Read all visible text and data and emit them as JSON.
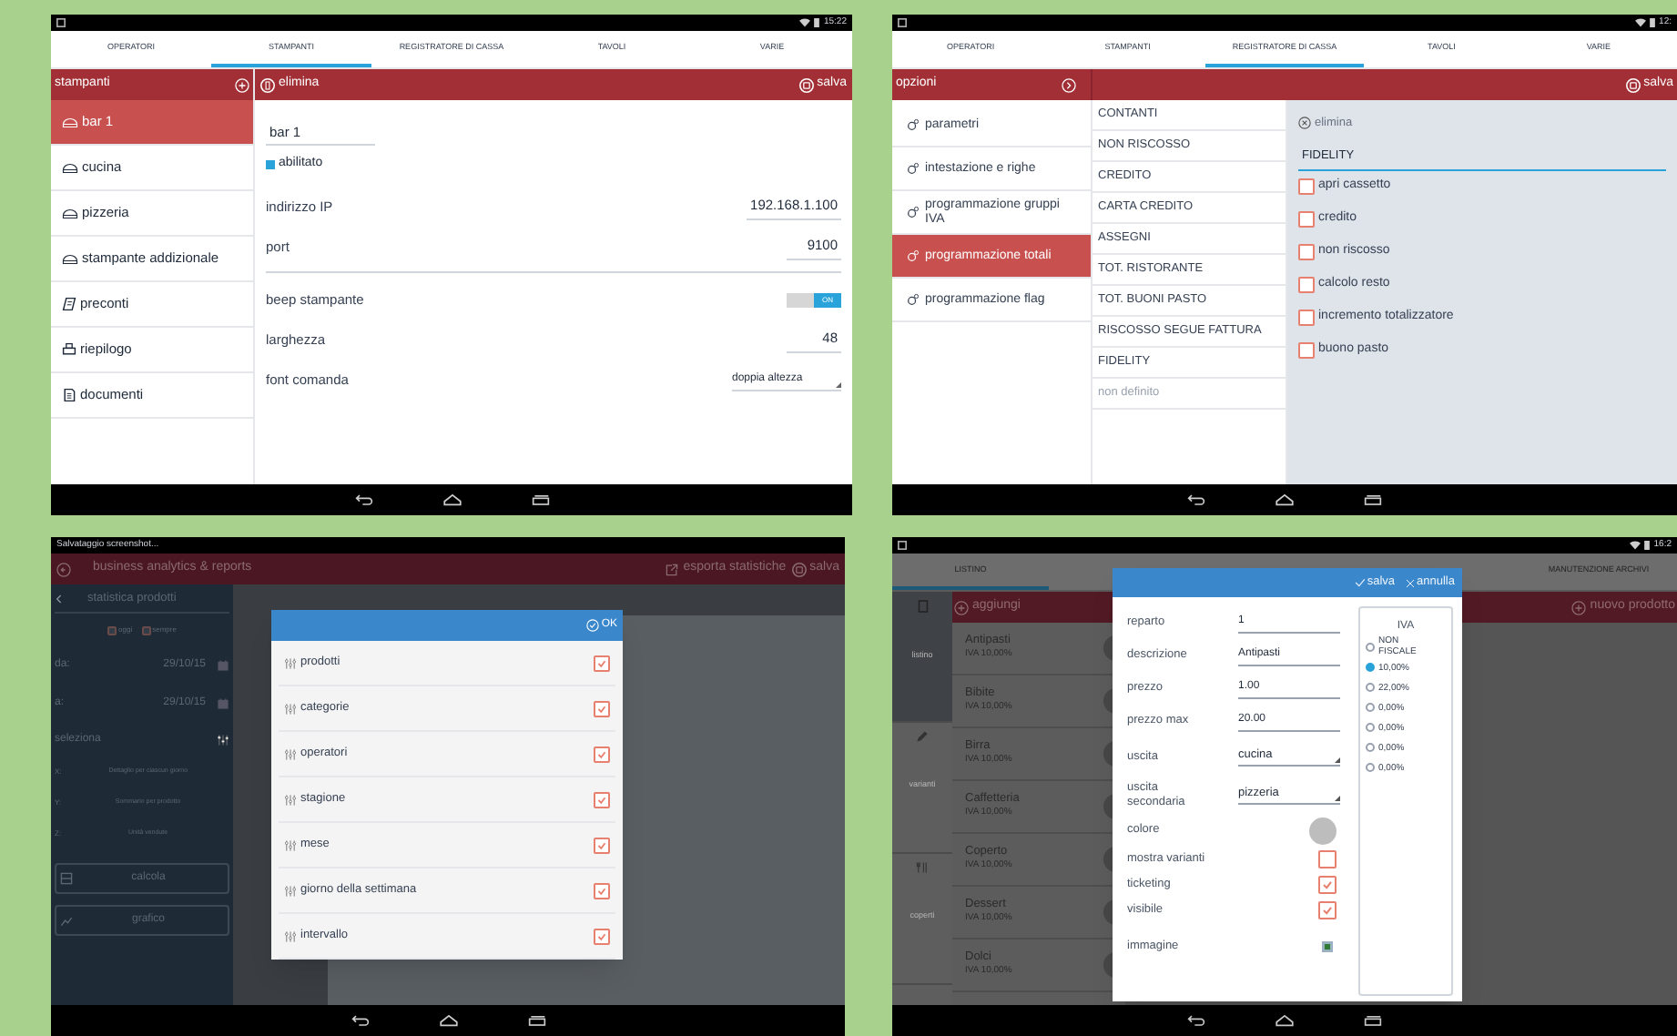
{
  "printers_screen": {
    "status_time": "15:22",
    "tabs": [
      {
        "label": "OPERATORI",
        "selected": false
      },
      {
        "label": "STAMPANTI",
        "selected": true
      },
      {
        "label": "REGISTRATORE DI CASSA",
        "selected": false
      },
      {
        "label": "TAVOLI",
        "selected": false
      },
      {
        "label": "VARIE",
        "selected": false
      }
    ],
    "sidebar": {
      "title": "stampanti",
      "items": [
        {
          "label": "bar 1",
          "kind": "printer",
          "selected": true
        },
        {
          "label": "cucina",
          "kind": "printer",
          "selected": false
        },
        {
          "label": "pizzeria",
          "kind": "printer",
          "selected": false
        },
        {
          "label": "stampante addizionale",
          "kind": "printer",
          "selected": false
        },
        {
          "label": "preconti",
          "kind": "receipt",
          "selected": false
        },
        {
          "label": "riepilogo",
          "kind": "summary",
          "selected": false
        },
        {
          "label": "documenti",
          "kind": "document",
          "selected": false
        }
      ]
    },
    "toolbar": {
      "delete": "elimina",
      "save": "salva"
    },
    "name_value": "bar 1",
    "enabled": {
      "label": "abilitato",
      "checked": true
    },
    "groups": [
      [
        {
          "kind": "field",
          "label": "indirizzo IP",
          "value": "192.168.1.100"
        },
        {
          "kind": "field",
          "label": "port",
          "value": "9100"
        }
      ],
      [
        {
          "kind": "toggle",
          "label": "beep stampante",
          "on": true,
          "value": "ON"
        },
        {
          "kind": "field",
          "label": "larghezza",
          "value": "48"
        },
        {
          "kind": "dropdown",
          "label": "font comanda",
          "value": "doppia altezza"
        }
      ]
    ]
  },
  "cash_register_screen": {
    "status_time": "12:",
    "tabs": [
      {
        "label": "OPERATORI",
        "selected": false
      },
      {
        "label": "STAMPANTI",
        "selected": false
      },
      {
        "label": "REGISTRATORE DI CASSA",
        "selected": true
      },
      {
        "label": "TAVOLI",
        "selected": false
      },
      {
        "label": "VARIE",
        "selected": false
      }
    ],
    "sidebar": {
      "title": "opzioni",
      "items": [
        {
          "label": "parametri",
          "selected": false
        },
        {
          "label": "intestazione e righe",
          "selected": false
        },
        {
          "label": "programmazione gruppi IVA",
          "selected": false
        },
        {
          "label": "programmazione totali",
          "selected": true
        },
        {
          "label": "programmazione flag",
          "selected": false
        }
      ]
    },
    "toolbar": {
      "save": "salva"
    },
    "totals": [
      {
        "label": "CONTANTI",
        "defined": true
      },
      {
        "label": "NON RISCOSSO",
        "defined": true
      },
      {
        "label": "CREDITO",
        "defined": true
      },
      {
        "label": "CARTA CREDITO",
        "defined": true
      },
      {
        "label": "ASSEGNI",
        "defined": true
      },
      {
        "label": "TOT. RISTORANTE",
        "defined": true
      },
      {
        "label": "TOT. BUONI PASTO",
        "defined": true
      },
      {
        "label": "RISCOSSO SEGUE FATTURA",
        "defined": true
      },
      {
        "label": "FIDELITY",
        "defined": true
      },
      {
        "label": "non definito",
        "defined": false
      }
    ],
    "detail": {
      "delete": "elimina",
      "name_value": "FIDELITY",
      "options": [
        {
          "label": "apri cassetto",
          "checked": false
        },
        {
          "label": "credito",
          "checked": false
        },
        {
          "label": "non riscosso",
          "checked": false
        },
        {
          "label": "calcolo resto",
          "checked": false
        },
        {
          "label": "incremento totalizzatore",
          "checked": false
        },
        {
          "label": "buono pasto",
          "checked": false
        }
      ]
    }
  },
  "analytics_screen": {
    "status_text": "Salvataggio screenshot...",
    "header": {
      "title": "business analytics & reports",
      "export": "esporta statistiche",
      "save": "salva"
    },
    "sidebar": {
      "title": "statistica prodotti",
      "periods": [
        {
          "label": "oggi",
          "checked": false
        },
        {
          "label": "sempre",
          "checked": false
        }
      ],
      "dates": [
        {
          "label": "da:",
          "value": "29/10/15"
        },
        {
          "label": "a:",
          "value": "29/10/15"
        }
      ],
      "select_label": "seleziona",
      "axes": [
        {
          "label": "X:",
          "value": "Dettaglio per ciascun giorno"
        },
        {
          "label": "Y:",
          "value": "Sommario per prodotto"
        },
        {
          "label": "Z:",
          "value": "Unità vendute"
        }
      ],
      "buttons": [
        {
          "kind": "calculate",
          "label": "calcola"
        },
        {
          "kind": "chart",
          "label": "grafico"
        }
      ]
    },
    "dialog": {
      "ok": "OK",
      "items": [
        {
          "label": "prodotti",
          "checked": true
        },
        {
          "label": "categorie",
          "checked": true
        },
        {
          "label": "operatori",
          "checked": true
        },
        {
          "label": "stagione",
          "checked": true
        },
        {
          "label": "mese",
          "checked": true
        },
        {
          "label": "giorno della settimana",
          "checked": true
        },
        {
          "label": "intervallo",
          "checked": true
        }
      ]
    }
  },
  "price_list_screen": {
    "status_time": "16:2",
    "tabs": [
      {
        "label": "LISTINO",
        "selected": true
      },
      {
        "label": "MANUTENZIONE ARCHIVI",
        "selected": false
      }
    ],
    "rail": [
      {
        "kind": "list",
        "label": "listino",
        "selected": true
      },
      {
        "kind": "variants",
        "label": "varianti",
        "selected": false
      },
      {
        "kind": "covers",
        "label": "coperti",
        "selected": false
      }
    ],
    "toolbar": {
      "add": "aggiungi",
      "new_product": "nuovo prodotto"
    },
    "products": [
      {
        "name": "Antipasti",
        "vat": "IVA 10,00%"
      },
      {
        "name": "Bibite",
        "vat": "IVA 10,00%"
      },
      {
        "name": "Birra",
        "vat": "IVA 10,00%"
      },
      {
        "name": "Caffetteria",
        "vat": "IVA 10,00%"
      },
      {
        "name": "Coperto",
        "vat": "IVA 10,00%"
      },
      {
        "name": "Dessert",
        "vat": "IVA 10,00%"
      },
      {
        "name": "Dolci",
        "vat": "IVA 10,00%"
      }
    ],
    "dialog": {
      "save": "salva",
      "cancel": "annulla",
      "fields": [
        {
          "kind": "text",
          "label": "reparto",
          "value": "1"
        },
        {
          "kind": "text",
          "label": "descrizione",
          "value": "Antipasti"
        },
        {
          "kind": "text",
          "label": "prezzo",
          "value": "1.00"
        },
        {
          "kind": "text",
          "label": "prezzo max",
          "value": "20.00"
        },
        {
          "kind": "dropdown",
          "label": "uscita",
          "value": "cucina"
        },
        {
          "kind": "dropdown",
          "label": "uscita secondaria",
          "value": "pizzeria"
        },
        {
          "kind": "color",
          "label": "colore",
          "color": "#bdbdbd"
        },
        {
          "kind": "checkbox",
          "label": "mostra varianti",
          "checked": false
        },
        {
          "kind": "checkbox",
          "label": "ticketing",
          "checked": true
        },
        {
          "kind": "checkbox",
          "label": "visibile",
          "checked": true
        },
        {
          "kind": "image",
          "label": "immagine"
        }
      ],
      "vat": {
        "title": "IVA",
        "options": [
          {
            "label": "NON FISCALE",
            "selected": false
          },
          {
            "label": "10,00%",
            "selected": true
          },
          {
            "label": "22,00%",
            "selected": false
          },
          {
            "label": "0,00%",
            "selected": false
          },
          {
            "label": "0,00%",
            "selected": false
          },
          {
            "label": "0,00%",
            "selected": false
          },
          {
            "label": "0,00%",
            "selected": false
          }
        ]
      }
    }
  }
}
